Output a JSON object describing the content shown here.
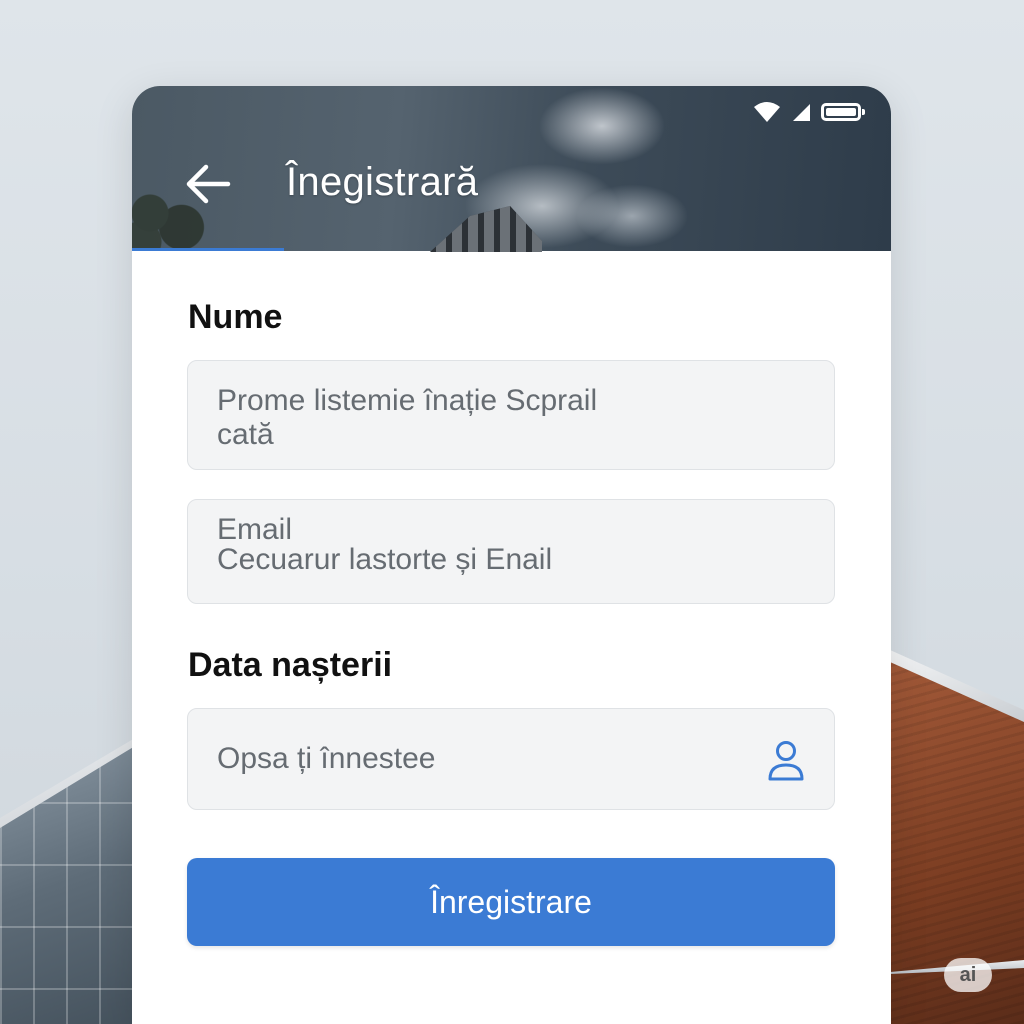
{
  "header": {
    "title": "Înegistrară",
    "back_icon": "arrow-left-icon"
  },
  "status_bar": {
    "icons": [
      "wifi-icon",
      "signal-icon",
      "battery-icon"
    ]
  },
  "form": {
    "name_label": "Nume",
    "name_field_line1": "Prome listemie înație Scprail",
    "name_field_line2": "cată",
    "email_field_line1": "Email",
    "email_field_line2": "Cecuarur lastorte și Enail",
    "birth_label": "Data nașterii",
    "birth_field": "Opsa ți înnestee",
    "birth_icon": "user-icon",
    "submit_label": "Înregistrare"
  },
  "watermark": "ai",
  "colors": {
    "accent": "#3b7bd4",
    "field_bg": "#f3f4f5",
    "header_text": "#ffffff"
  }
}
